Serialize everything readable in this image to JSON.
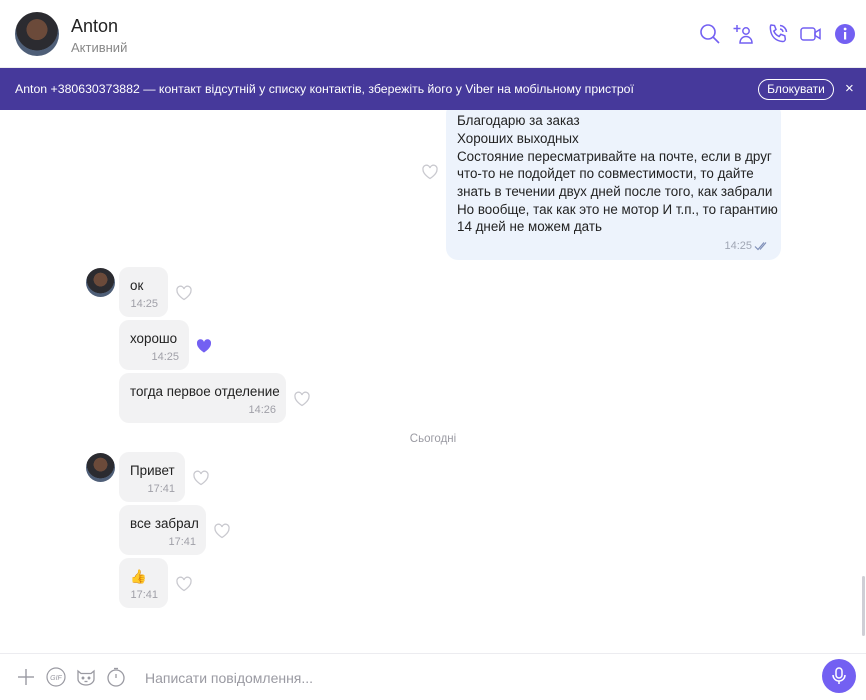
{
  "header": {
    "contact_name": "Anton",
    "contact_status": "Активний",
    "icons": [
      "search-icon",
      "add-participant-icon",
      "voice-call-icon",
      "video-call-icon",
      "info-icon"
    ]
  },
  "banner": {
    "text": "Anton +380630373882 — контакт відсутній у списку контактів, збережіть його у Viber на мобільному пристрої",
    "block_label": "Блокувати",
    "close_symbol": "×"
  },
  "messages": {
    "outgoing": {
      "lines": [
        "Благодарю за заказ",
        "Хороших выходных",
        "Состояние пересматривайте на почте, если в друг",
        "что-то не подойдет по совместимости, то дайте",
        "знать в течении двух дней после того, как забрали",
        "Но вообще, так как это не мотор И т.п., то гарантию",
        "14 дней не можем дать"
      ],
      "time": "14:25"
    },
    "group1": [
      {
        "text": "ок",
        "time": "14:25",
        "liked": false
      },
      {
        "text": "хорошо",
        "time": "14:25",
        "liked": true
      },
      {
        "text": "тогда первое отделение",
        "time": "14:26",
        "liked": false
      }
    ],
    "day_separator": "Сьогодні",
    "group2": [
      {
        "text": "Привет",
        "time": "17:41",
        "liked": false
      },
      {
        "text": "все забрал",
        "time": "17:41",
        "liked": false
      },
      {
        "text": "👍",
        "time": "17:41",
        "liked": false
      }
    ]
  },
  "composer": {
    "placeholder": "Написати повідомлення..."
  },
  "colors": {
    "brand": "#7360f2",
    "banner": "#46399b",
    "outgoing_bubble": "#edf3fc",
    "incoming_bubble": "#f2f2f3"
  }
}
